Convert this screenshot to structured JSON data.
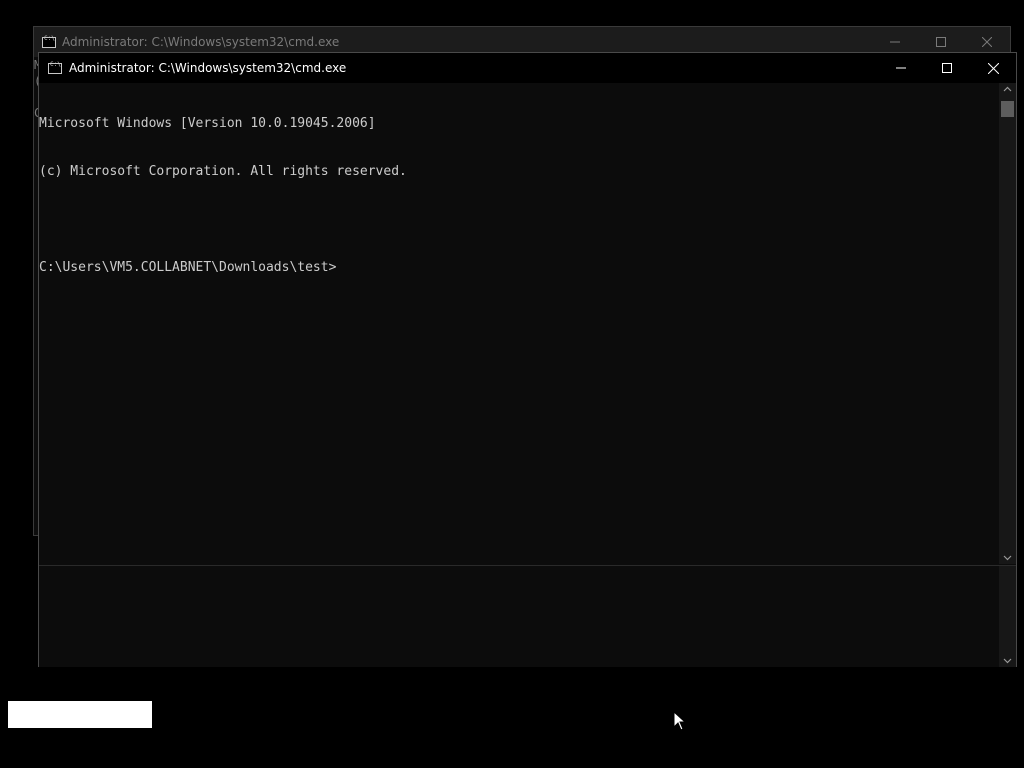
{
  "background_window": {
    "title": "Administrator: C:\\Windows\\system32\\cmd.exe",
    "peek_lines": [
      "M",
      "(",
      "",
      "C"
    ]
  },
  "foreground_window": {
    "title": "Administrator: C:\\Windows\\system32\\cmd.exe",
    "console_lines": [
      "Microsoft Windows [Version 10.0.19045.2006]",
      "(c) Microsoft Corporation. All rights reserved.",
      "",
      "C:\\Users\\VM5.COLLABNET\\Downloads\\test>"
    ]
  },
  "icons": {
    "window_icon": "cmd-icon",
    "minimize": "minimize-icon",
    "maximize": "maximize-icon",
    "close": "close-icon",
    "scroll_up": "chevron-up-icon",
    "scroll_down": "chevron-down-icon",
    "cursor": "mouse-pointer-icon"
  },
  "colors": {
    "console_bg": "#0c0c0c",
    "console_text": "#cccccc",
    "titlebar_active": "#000000",
    "titlebar_inactive": "#1c1c1c"
  }
}
